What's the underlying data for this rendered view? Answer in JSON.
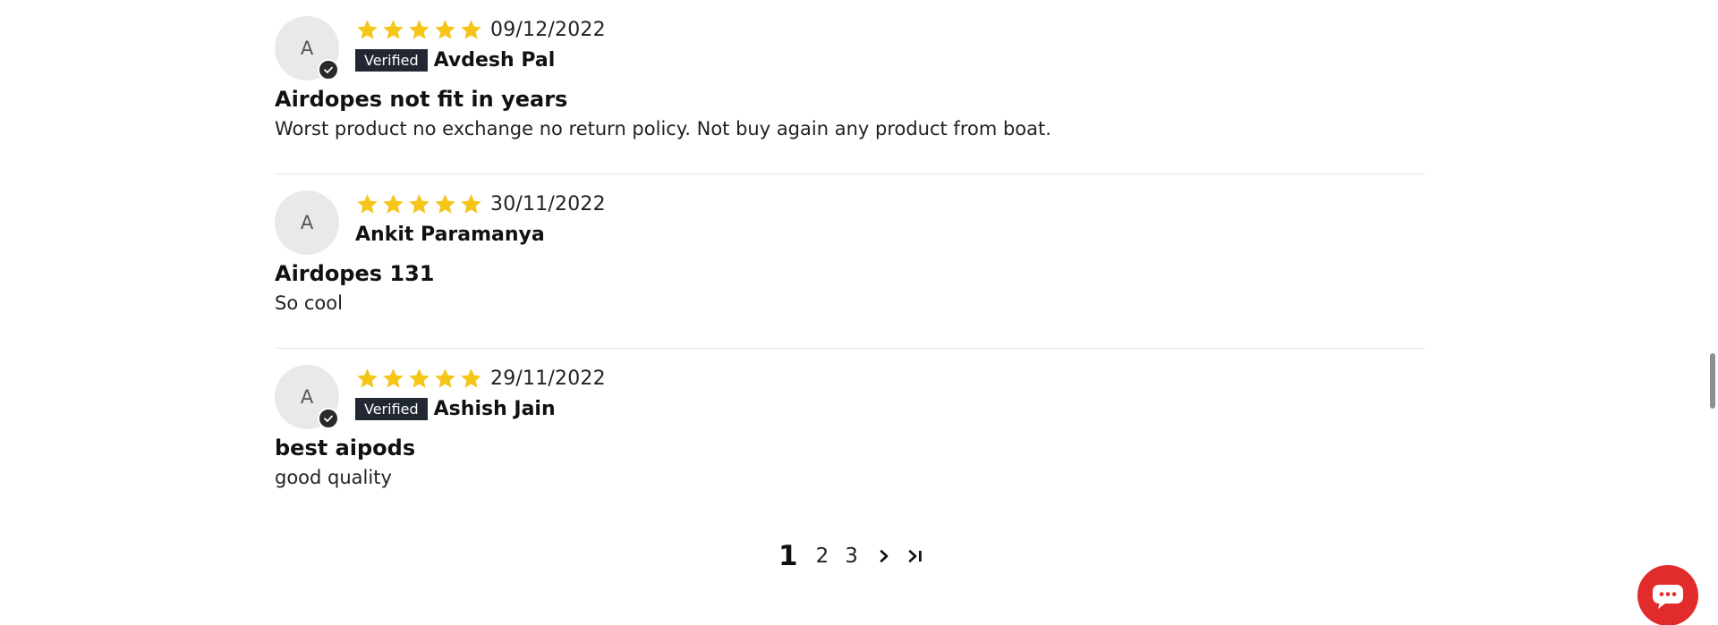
{
  "reviews": [
    {
      "avatar_initial": "A",
      "verified": true,
      "rating": 5,
      "date": "09/12/2022",
      "verified_label": "Verified",
      "name": "Avdesh Pal",
      "title": "Airdopes not fit in years",
      "body": "Worst product no exchange no return policy. Not buy again any product from boat."
    },
    {
      "avatar_initial": "A",
      "verified": false,
      "rating": 5,
      "date": "30/11/2022",
      "name": "Ankit Paramanya",
      "title": "Airdopes 131",
      "body": "So cool"
    },
    {
      "avatar_initial": "A",
      "verified": true,
      "rating": 5,
      "date": "29/11/2022",
      "verified_label": "Verified",
      "name": "Ashish Jain",
      "title": "best aipods",
      "body": "good quality"
    }
  ],
  "pagination": {
    "current": "1",
    "pages": [
      "2",
      "3"
    ],
    "next_icon": "chevron-right-icon",
    "last_icon": "last-page-icon"
  },
  "colors": {
    "star": "#f5c518",
    "verified_badge": "#222831",
    "chat_button": "#e22b2b"
  },
  "chat": {
    "icon": "chat-bubble-icon"
  }
}
